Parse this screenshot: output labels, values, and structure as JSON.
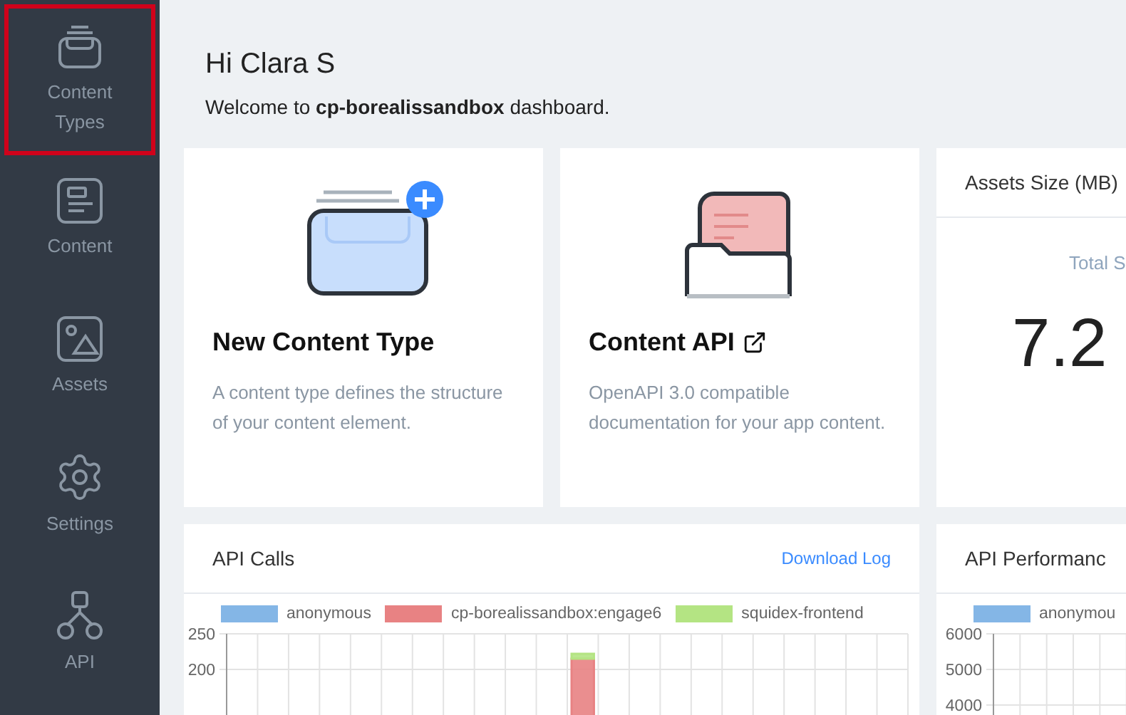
{
  "sidebar": {
    "items": [
      {
        "label": "Content Types",
        "selected": true
      },
      {
        "label": "Content",
        "selected": false
      },
      {
        "label": "Assets",
        "selected": false
      },
      {
        "label": "Settings",
        "selected": false
      },
      {
        "label": "API",
        "selected": false
      }
    ]
  },
  "header": {
    "greeting": "Hi Clara S",
    "welcome": "Welcome to **cp-borealissandbox** dashboard."
  },
  "cards": [
    {
      "kind": "new-type",
      "title": "New Content Type",
      "description": "A content type defines the structure of your content element."
    },
    {
      "kind": "api",
      "title": "Content API",
      "description": "OpenAPI 3.0 compatible documentation for your app content."
    }
  ],
  "assets_size": {
    "title": "Assets Size (MB)",
    "label": "Total S",
    "value": "7.2"
  },
  "api_calls": {
    "title": "API Calls",
    "action": "Download Log",
    "chart_data": {
      "type": "bar",
      "stacked": true,
      "ylim": [
        0,
        250
      ],
      "yticks": [
        200,
        250
      ],
      "series": [
        {
          "name": "anonymous",
          "color": "#84b6e6",
          "values": [
            0,
            0,
            0,
            0,
            0,
            0,
            0,
            0,
            0,
            0,
            0,
            0,
            0,
            0,
            0,
            0,
            0,
            0,
            0,
            0,
            0,
            0
          ]
        },
        {
          "name": "cp-borealissandbox:engage6",
          "color": "#e88283",
          "values": [
            0,
            0,
            0,
            0,
            0,
            0,
            0,
            0,
            0,
            0,
            0,
            215,
            0,
            0,
            0,
            0,
            0,
            0,
            0,
            0,
            0,
            0
          ]
        },
        {
          "name": "squidex-frontend",
          "color": "#b4e483",
          "values": [
            0,
            0,
            0,
            0,
            0,
            0,
            0,
            0,
            0,
            0,
            0,
            7,
            0,
            0,
            0,
            0,
            0,
            0,
            0,
            0,
            0,
            0
          ]
        }
      ]
    }
  },
  "api_performance": {
    "title": "API Performanc",
    "chart_data": {
      "type": "bar",
      "ylim": [
        0,
        6000
      ],
      "yticks": [
        4000,
        5000,
        6000
      ],
      "series": [
        {
          "name": "anonymou",
          "color": "#84b6e6"
        }
      ]
    }
  }
}
